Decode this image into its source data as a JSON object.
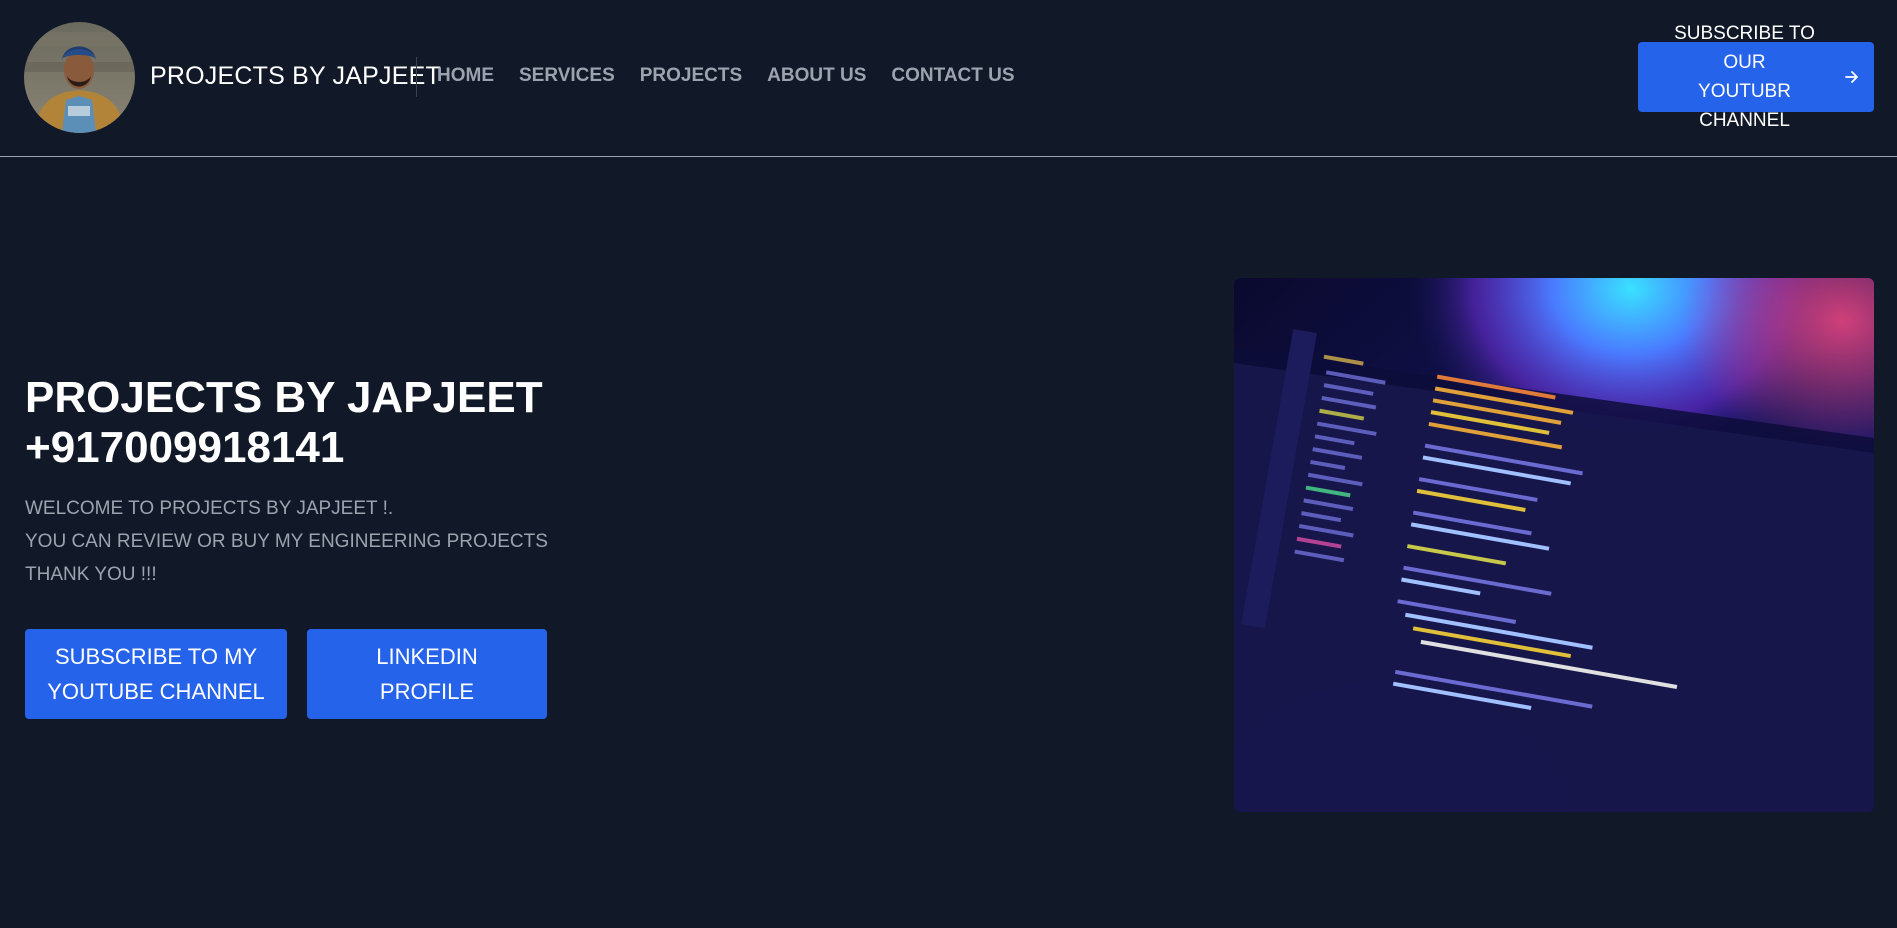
{
  "header": {
    "brand_title": "PROJECTS BY JAPJEET",
    "avatar_alt": "profile photo",
    "nav": [
      "HOME",
      "SERVICES",
      "PROJECTS",
      "ABOUT US",
      "CONTACT US"
    ],
    "cta_line1": "SUBSCRIBE TO OUR",
    "cta_line2": "YOUTUBR CHANNEL",
    "cta_icon": "arrow-right-icon"
  },
  "hero": {
    "title_line1": "PROJECTS BY JAPJEET",
    "title_line2": "+917009918141",
    "text_line1": "WELCOME TO PROJECTS BY JAPJEET !.",
    "text_line2": "YOU CAN REVIEW OR BUY MY ENGINEERING PROJECTS",
    "text_line3": "THANK YOU !!!",
    "btn_youtube_line1": "SUBSCRIBE TO MY",
    "btn_youtube_line2": "YOUTUBE CHANNEL",
    "btn_linkedin_line1": "LINKEDIN",
    "btn_linkedin_line2": "PROFILE",
    "image_desc": "code editor on laptop screen"
  },
  "colors": {
    "background": "#111827",
    "accent": "#2563eb",
    "nav_text": "#9ca3af",
    "heading": "#ffffff"
  }
}
